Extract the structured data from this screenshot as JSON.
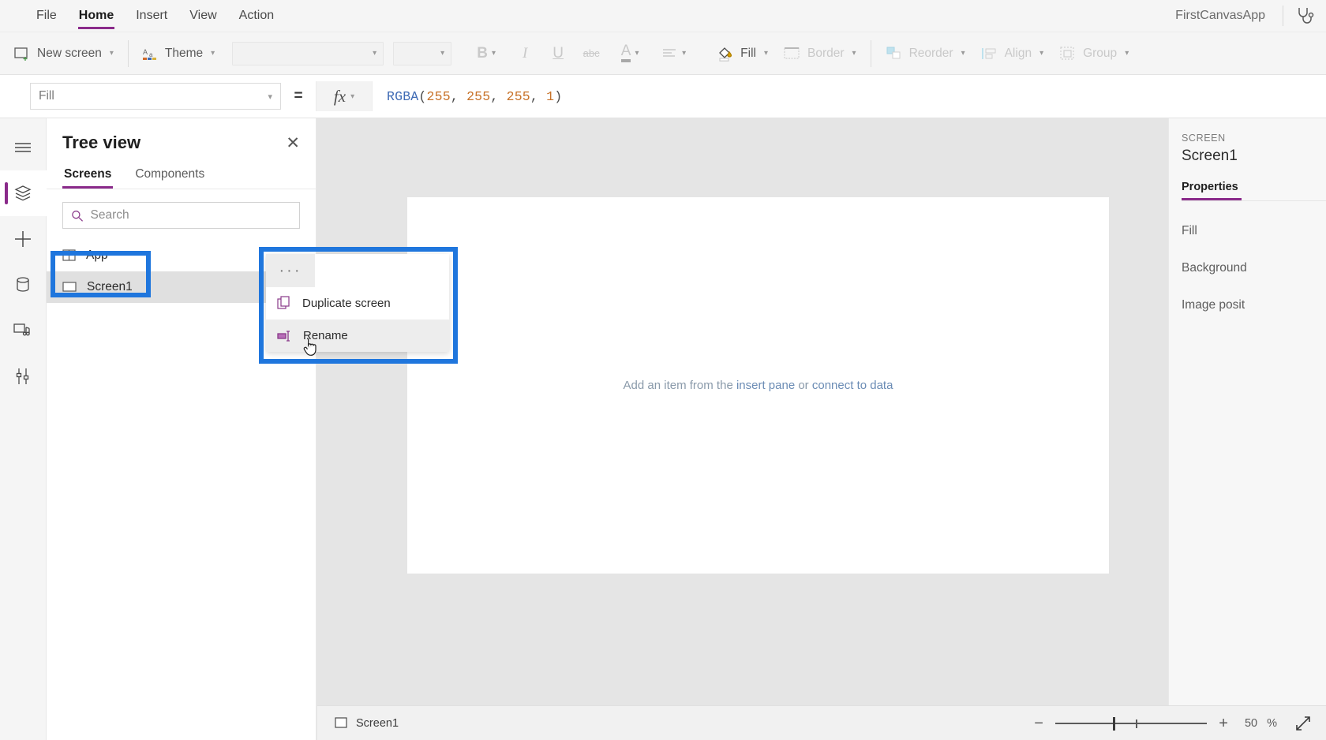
{
  "menubar": {
    "items": [
      {
        "label": "File",
        "active": false
      },
      {
        "label": "Home",
        "active": true
      },
      {
        "label": "Insert",
        "active": false
      },
      {
        "label": "View",
        "active": false
      },
      {
        "label": "Action",
        "active": false
      }
    ],
    "app_title": "FirstCanvasApp",
    "checker_icon": "stethoscope-icon"
  },
  "ribbon": {
    "new_screen": "New screen",
    "theme": "Theme",
    "font_family_value": "",
    "font_size_value": "",
    "bold": "B",
    "italic": "I",
    "underline": "U",
    "strikethrough": "abc",
    "font_color": "A",
    "align": "align-icon",
    "fill": "Fill",
    "border": "Border",
    "reorder": "Reorder",
    "align_group": "Align",
    "group": "Group"
  },
  "formulabar": {
    "property": "Fill",
    "equals": "=",
    "fx_label": "fx",
    "formula": {
      "function": "RGBA",
      "open": "(",
      "args": [
        "255",
        "255",
        "255",
        "1"
      ],
      "close": ")",
      "full_text": "RGBA(255, 255, 255, 1)"
    }
  },
  "rail": {
    "items": [
      {
        "name": "hamburger-menu-icon",
        "active": false
      },
      {
        "name": "tree-view-icon",
        "active": true
      },
      {
        "name": "insert-plus-icon",
        "active": false
      },
      {
        "name": "data-cylinder-icon",
        "active": false
      },
      {
        "name": "media-icon",
        "active": false
      },
      {
        "name": "tools-icon",
        "active": false
      }
    ]
  },
  "treeview": {
    "title": "Tree view",
    "close_icon": "close-icon",
    "tabs": [
      {
        "label": "Screens",
        "active": true
      },
      {
        "label": "Components",
        "active": false
      }
    ],
    "search_placeholder": "Search",
    "search_value": "",
    "items": [
      {
        "label": "App",
        "icon": "app-icon",
        "selected": false
      },
      {
        "label": "Screen1",
        "icon": "screen-icon",
        "selected": true
      }
    ]
  },
  "contextmenu": {
    "ellipsis": "···",
    "items": [
      {
        "label": "Duplicate screen",
        "icon": "duplicate-icon",
        "hovered": false
      },
      {
        "label": "Rename",
        "icon": "rename-icon",
        "hovered": true
      }
    ]
  },
  "canvas": {
    "hint_prefix": "Add an item from the ",
    "hint_link1": "insert pane",
    "hint_middle": " or ",
    "hint_link2": "connect to data"
  },
  "rightpane": {
    "kicker": "SCREEN",
    "title": "Screen1",
    "tabs": [
      {
        "label": "Properties",
        "active": true
      }
    ],
    "properties": [
      "Fill",
      "Background",
      "Image posit"
    ]
  },
  "statusbar": {
    "screen_label": "Screen1",
    "zoom_out": "−",
    "zoom_in": "+",
    "zoom_value": "50",
    "zoom_unit": "%",
    "expand_icon": "expand-icon"
  },
  "colors": {
    "accent": "#8a2a8a",
    "annotation": "#1f76dd",
    "chrome": "#f5f5f5",
    "canvas_bg": "#e5e5e5",
    "formula_fn": "#3f6bb5",
    "formula_num": "#c8732a"
  }
}
